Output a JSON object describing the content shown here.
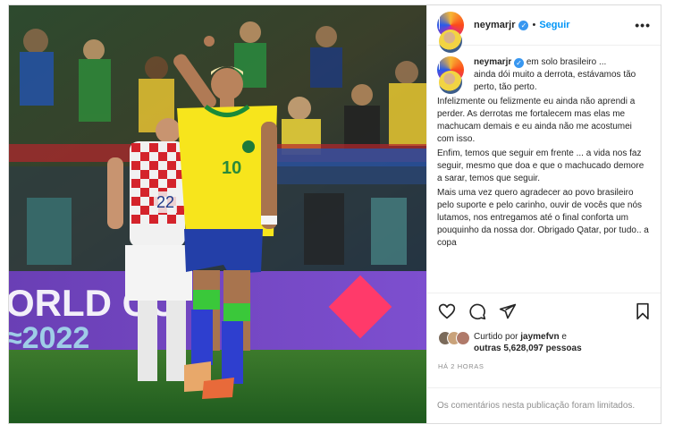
{
  "post": {
    "username": "neymarjr",
    "follow_label": "Seguir",
    "separator": "•",
    "more_label": "•••",
    "caption_lines": [
      "em solo brasileiro ...",
      "ainda dói muito a derrota, estávamos tão perto, tão perto.",
      "Infelizmente ou felizmente eu ainda não aprendi a perder. As derrotas me fortalecem mas elas me machucam demais e eu ainda não me acostumei com isso.",
      "Enfim, temos que seguir em frente ... a vida nos faz seguir, mesmo que doa e que o machucado demore a sarar, temos que seguir.",
      "Mais uma vez quero agradecer ao povo brasileiro pelo suporte e pelo carinho, ouvir de vocês que nós lutamos, nos entregamos até o final conforta um pouquinho da nossa dor. Obrigado Qatar, por tudo.. a copa"
    ],
    "liked_by_prefix": "Curtido por",
    "liked_by_user": "jaymefvn",
    "liked_by_and": "e",
    "liked_by_others": "outras 5,628,097 pessoas",
    "time_ago": "HÁ 2 HORAS",
    "comments_limited": "Os comentários nesta publicação foram limitados."
  },
  "photo": {
    "banner_text": "ORLD CO",
    "banner_year": "≈2022",
    "player_number": "10",
    "opponent_number": "22"
  },
  "icons": {
    "verified": "verified-badge",
    "like": "heart-icon",
    "comment": "comment-icon",
    "share": "send-icon",
    "save": "bookmark-icon"
  }
}
